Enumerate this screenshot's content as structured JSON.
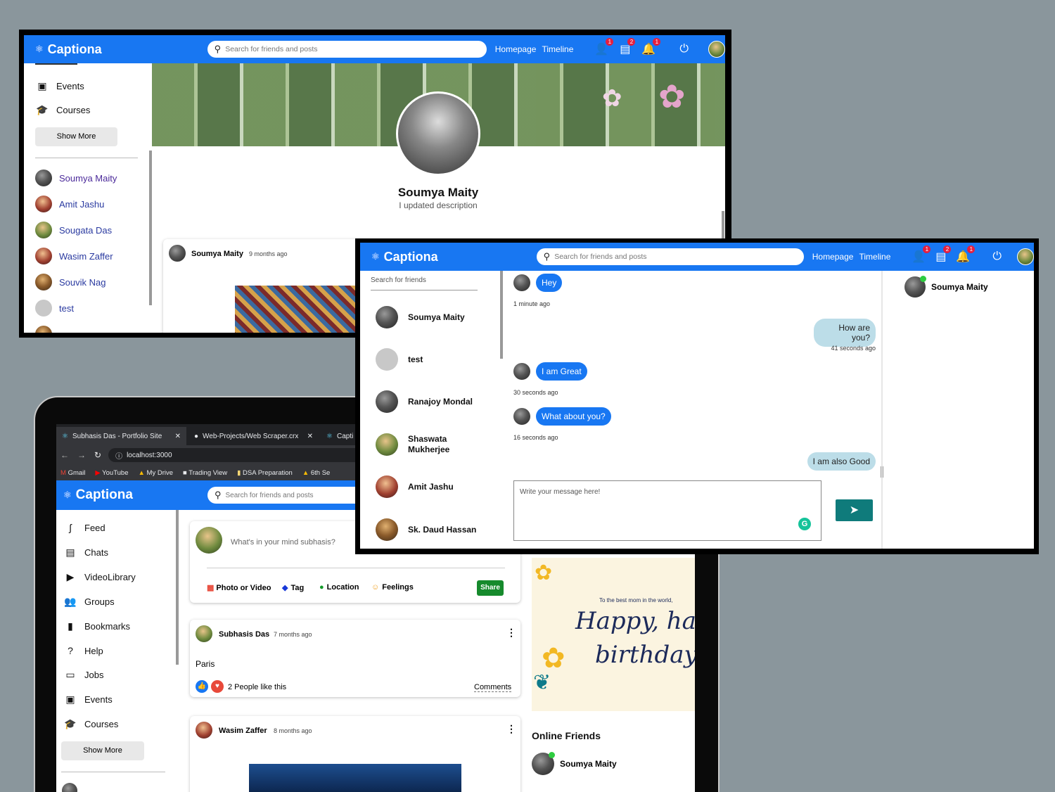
{
  "app": {
    "logo": "Captiona",
    "search_placeholder": "Search for friends and posts",
    "nav_homepage": "Homepage",
    "nav_timeline": "Timeline",
    "badge_friends": "1",
    "badge_chats": "2",
    "badge_notifications": "1"
  },
  "profile_window": {
    "sidebar_items": [
      {
        "label": "Events",
        "icon": "calendar-icon"
      },
      {
        "label": "Courses",
        "icon": "school-icon"
      }
    ],
    "show_more": "Show More",
    "friends": [
      "Soumya Maity",
      "Amit Jashu",
      "Sougata Das",
      "Wasim Zaffer",
      "Souvik Nag",
      "test"
    ],
    "profile_name": "Soumya Maity",
    "profile_desc": "I updated description",
    "post_author": "Soumya Maity",
    "post_time": "9 months ago"
  },
  "chat_window": {
    "search_friends_placeholder": "Search for friends",
    "conversations": [
      "Soumya Maity",
      "test",
      "Ranajoy Mondal",
      "Shaswata Mukherjee",
      "Amit Jashu",
      "Sk. Daud Hassan"
    ],
    "messages": [
      {
        "text": "Hey",
        "time": "1 minute ago",
        "dir": "in"
      },
      {
        "text": "How are you?",
        "time": "41 seconds ago",
        "dir": "out"
      },
      {
        "text": "I am Great",
        "time": "30 seconds ago",
        "dir": "in"
      },
      {
        "text": "What about you?",
        "time": "16 seconds ago",
        "dir": "in"
      },
      {
        "text": "I am also Good",
        "time": "",
        "dir": "out"
      }
    ],
    "message_placeholder": "Write your message here!",
    "online_friend": "Soumya Maity"
  },
  "laptop_window": {
    "tabs": [
      {
        "label": "Subhasis Das - Portfolio Site"
      },
      {
        "label": "Web-Projects/Web Scraper.crx at"
      },
      {
        "label": "Capti"
      }
    ],
    "url": "localhost:3000",
    "bookmarks": [
      "Gmail",
      "YouTube",
      "My Drive",
      "Trading View",
      "DSA Preparation",
      "6th Se"
    ],
    "sidebar_items": [
      {
        "label": "Feed",
        "icon": "rss-icon"
      },
      {
        "label": "Chats",
        "icon": "chat-icon"
      },
      {
        "label": "VideoLibrary",
        "icon": "play-icon"
      },
      {
        "label": "Groups",
        "icon": "groups-icon"
      },
      {
        "label": "Bookmarks",
        "icon": "bookmark-icon"
      },
      {
        "label": "Help",
        "icon": "help-icon"
      },
      {
        "label": "Jobs",
        "icon": "briefcase-icon"
      },
      {
        "label": "Events",
        "icon": "calendar-icon"
      },
      {
        "label": "Courses",
        "icon": "school-icon"
      }
    ],
    "show_more": "Show More",
    "share_placeholder": "What's in your mind subhasis?",
    "share_options": [
      "Photo or Video",
      "Tag",
      "Location",
      "Feelings"
    ],
    "share_button": "Share",
    "post1": {
      "author": "Subhasis Das",
      "time": "7 months ago",
      "text": "Paris",
      "likes": "2 People like this",
      "comments": "Comments"
    },
    "post2": {
      "author": "Wasim Zaffer",
      "time": "8 months ago"
    },
    "birthday_small": "To the best mom in the world,",
    "birthday_big1": "Happy, happy",
    "birthday_big2": "birthday!",
    "online_title": "Online Friends",
    "online_friend": "Soumya Maity"
  },
  "colors": {
    "brand": "#1877f2",
    "background": "#8a969c",
    "send": "#0f7b7b",
    "share": "#168a2c"
  }
}
